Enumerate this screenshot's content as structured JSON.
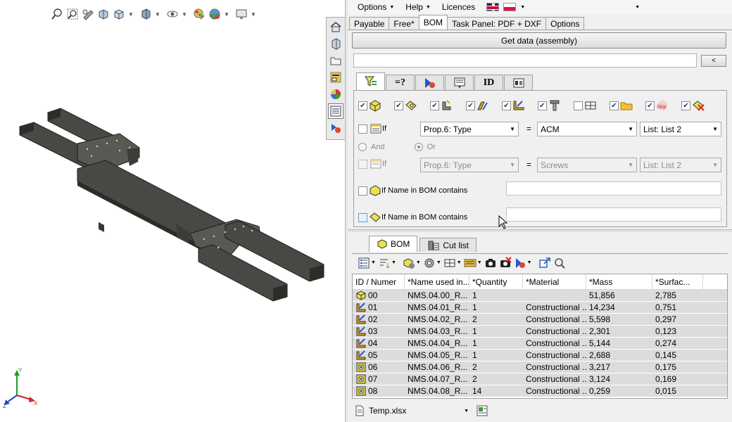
{
  "viewport": {
    "toolbar_icons": [
      "zoom-to-fit-icon",
      "zoom-to-area-icon",
      "previous-view-icon",
      "section-view-icon",
      "view-orientation-icon",
      "display-style-icon",
      "hide-show-icon",
      "edit-appearance-icon",
      "apply-scene-icon",
      "view-settings-icon"
    ],
    "triad": {
      "x": "X",
      "y": "Y",
      "z": "Z"
    }
  },
  "taskpane": {
    "icons": [
      "home-icon",
      "parts-icon",
      "folder-icon",
      "file-explorer-icon",
      "appearance-icon",
      "properties-list-icon",
      "addin-icon"
    ]
  },
  "menu": {
    "options": "Options",
    "help": "Help",
    "licences": "Licences"
  },
  "tabs": [
    "Payable",
    "Free*",
    "BOM",
    "Task Panel: PDF + DXF",
    "Options"
  ],
  "actions": {
    "get_data": "Get data (assembly)",
    "back": "<"
  },
  "path_field": {
    "value": ""
  },
  "filter_tabs": [
    "filter-icon",
    "=?",
    "config-icon",
    "export-icon",
    "ID",
    "settings-icon"
  ],
  "filter": {
    "cond1": {
      "label": "If",
      "prop": "Prop.6: Type",
      "eq": "=",
      "value": "ACM",
      "list": "List: List 2"
    },
    "logic": {
      "and": "And",
      "or": "Or"
    },
    "cond2": {
      "label": "If",
      "prop": "Prop.6: Type",
      "eq": "=",
      "value": "Screws",
      "list": "List: List 2"
    },
    "name1": {
      "label": "If Name in BOM contains",
      "value": ""
    },
    "name2": {
      "label": "If Name in BOM contains",
      "value": ""
    },
    "skip_label": "Skip"
  },
  "bom_tabs": {
    "bom": "BOM",
    "cut_list": "Cut list"
  },
  "table": {
    "headers": [
      "ID / Numer",
      "*Name used in...",
      "*Quantity",
      "*Material",
      "*Mass",
      "*Surfac..."
    ],
    "rows": [
      {
        "icon": "assembly",
        "id": "00",
        "name": "NMS.04.00_R...",
        "qty": "1",
        "material": "",
        "mass": "51,856",
        "surface": "2,785"
      },
      {
        "icon": "weldment",
        "id": "01",
        "name": "NMS.04.01_R...",
        "qty": "1",
        "material": "Constructional ...",
        "mass": "14,234",
        "surface": "0,751"
      },
      {
        "icon": "weldment",
        "id": "02",
        "name": "NMS.04.02_R...",
        "qty": "2",
        "material": "Constructional ...",
        "mass": "5,598",
        "surface": "0,297"
      },
      {
        "icon": "weldment",
        "id": "03",
        "name": "NMS.04.03_R...",
        "qty": "1",
        "material": "Constructional ...",
        "mass": "2,301",
        "surface": "0,123"
      },
      {
        "icon": "weldment",
        "id": "04",
        "name": "NMS.04.04_R...",
        "qty": "1",
        "material": "Constructional ...",
        "mass": "5,144",
        "surface": "0,274"
      },
      {
        "icon": "weldment",
        "id": "05",
        "name": "NMS.04.05_R...",
        "qty": "1",
        "material": "Constructional ...",
        "mass": "2,688",
        "surface": "0,145"
      },
      {
        "icon": "sheet",
        "id": "06",
        "name": "NMS.04.06_R...",
        "qty": "2",
        "material": "Constructional ...",
        "mass": "3,217",
        "surface": "0,175"
      },
      {
        "icon": "sheet",
        "id": "07",
        "name": "NMS.04.07_R...",
        "qty": "2",
        "material": "Constructional ...",
        "mass": "3,124",
        "surface": "0,169"
      },
      {
        "icon": "sheet",
        "id": "08",
        "name": "NMS.04.08_R...",
        "qty": "14",
        "material": "Constructional ...",
        "mass": "0,259",
        "surface": "0,015"
      }
    ]
  },
  "footer": {
    "file": "Temp.xlsx"
  },
  "colors": {
    "steel": "#4a4844",
    "steel_dark": "#2e2c29",
    "rowbg": "#dcdcdc"
  }
}
